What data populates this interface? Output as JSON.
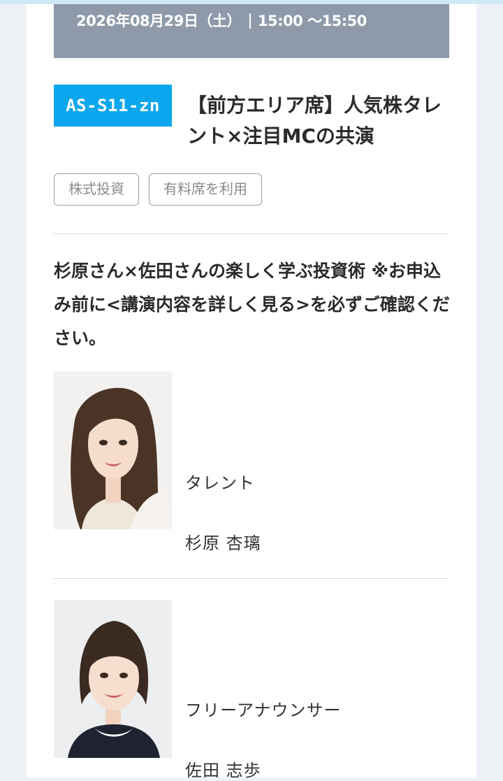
{
  "session": {
    "date": "2026年08月29日（土）",
    "time": "15:00 〜15:50",
    "code": "AS-S11-zn",
    "title": "【前方エリア席】人気株タレント×注目MCの共演",
    "tags": [
      "株式投資",
      "有料席を利用"
    ],
    "description": "杉原さん×佐田さんの楽しく学ぶ投資術 ※お申込み前に<講演内容を詳しく見る>を必ずご確認ください。"
  },
  "speakers": [
    {
      "role": "タレント",
      "name": "杉原 杏璃",
      "photo_icon": "speaker-photo"
    },
    {
      "role": "フリーアナウンサー",
      "name": "佐田 志歩",
      "photo_icon": "speaker-photo"
    }
  ],
  "colors": {
    "date_bar_bg": "#8e9aaa",
    "badge_bg": "#0aa6ee",
    "page_bg": "#eef2f7",
    "top_strip": "#cfe9f6"
  }
}
